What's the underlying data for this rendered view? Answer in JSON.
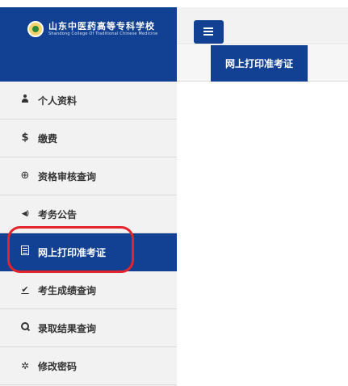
{
  "brand": {
    "name_cn": "山东中医药高等专科学校",
    "name_en": "Shandong College Of Traditional Chinese Medicine",
    "color": "#124193"
  },
  "accent_color": "#124193",
  "highlight_color": "#e3242b",
  "sidebar": {
    "items": [
      {
        "label": "个人资料",
        "icon": "user-icon",
        "glyph": ""
      },
      {
        "label": "缴费",
        "icon": "dollar-icon",
        "glyph": "$"
      },
      {
        "label": "资格审核查询",
        "icon": "zoom-in-icon",
        "glyph": "⊕"
      },
      {
        "label": "考务公告",
        "icon": "volume-icon",
        "glyph": "◀)"
      },
      {
        "label": "网上打印准考证",
        "icon": "file-list-icon",
        "glyph": "",
        "active": true
      },
      {
        "label": "考生成绩查询",
        "icon": "check-underline-icon",
        "glyph": "✔"
      },
      {
        "label": "录取结果查询",
        "icon": "search-icon",
        "glyph": ""
      },
      {
        "label": "修改密码",
        "icon": "gear-icon",
        "glyph": "✲"
      }
    ]
  },
  "toolbar": {
    "toggle_icon": "hamburger-menu-icon"
  },
  "tabs": [
    {
      "label": "网上打印准考证",
      "active": true
    }
  ]
}
